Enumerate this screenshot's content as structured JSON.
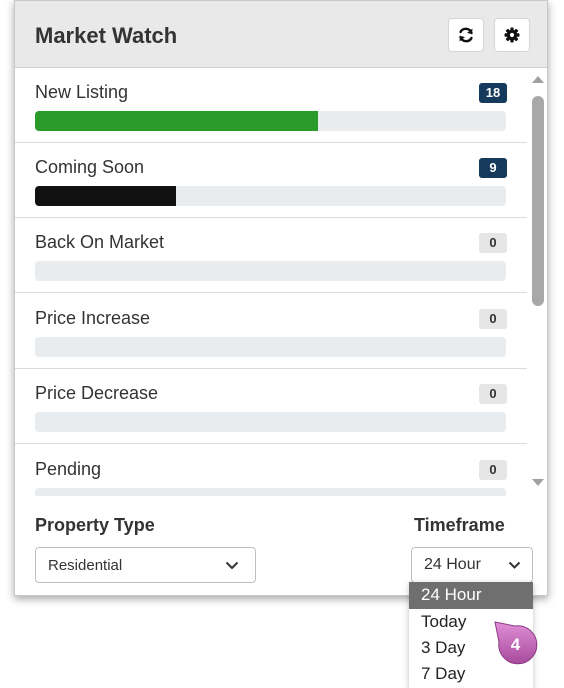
{
  "header": {
    "title": "Market Watch",
    "refresh_icon": "refresh-icon",
    "settings_icon": "gear-icon"
  },
  "colors": {
    "green_bar": "#2a9a2a",
    "black_bar": "#111111",
    "badge_dark": "#153a5c",
    "callout": "#c268b8"
  },
  "rows": [
    {
      "label": "New Listing",
      "count": "18",
      "fill_pct": 60,
      "bar_color": "#2a9a2a"
    },
    {
      "label": "Coming Soon",
      "count": "9",
      "fill_pct": 30,
      "bar_color": "#111111"
    },
    {
      "label": "Back On Market",
      "count": "0",
      "fill_pct": 0,
      "bar_color": "#888888"
    },
    {
      "label": "Price Increase",
      "count": "0",
      "fill_pct": 0,
      "bar_color": "#888888"
    },
    {
      "label": "Price Decrease",
      "count": "0",
      "fill_pct": 0,
      "bar_color": "#888888"
    },
    {
      "label": "Pending",
      "count": "0",
      "fill_pct": 0,
      "bar_color": "#888888"
    }
  ],
  "footer": {
    "property_type_label": "Property Type",
    "property_type_value": "Residential",
    "timeframe_label": "Timeframe",
    "timeframe_value": "24 Hour"
  },
  "timeframe_options": [
    "24 Hour",
    "Today",
    "3 Day",
    "7 Day"
  ],
  "timeframe_selected_index": 0,
  "callout_number": "4"
}
